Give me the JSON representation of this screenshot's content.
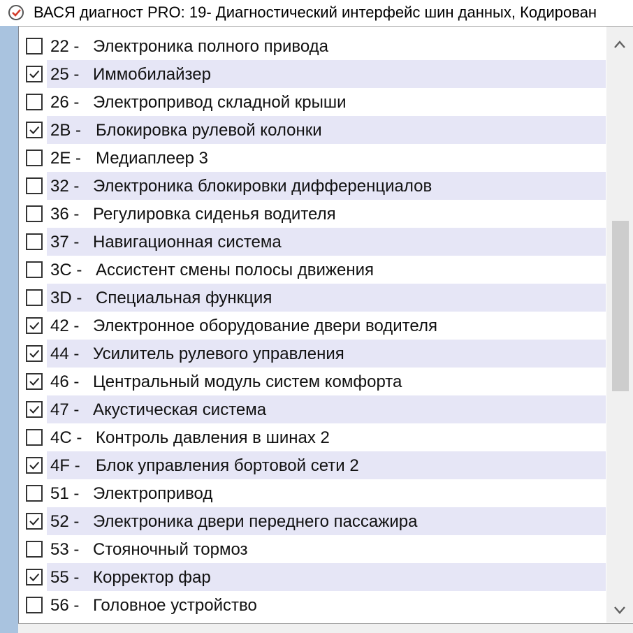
{
  "window": {
    "title": "ВАСЯ диагност PRO: 19- Диагностический интерфейс шин данных,  Кодирован"
  },
  "modules": [
    {
      "code": "22 -",
      "name": "Электроника полного привода",
      "checked": false
    },
    {
      "code": "25 -",
      "name": "Иммобилайзер",
      "checked": true
    },
    {
      "code": "26 -",
      "name": "Электропривод складной крыши",
      "checked": false
    },
    {
      "code": "2B -",
      "name": "Блокировка рулевой колонки",
      "checked": true
    },
    {
      "code": "2E -",
      "name": "Медиаплеер 3",
      "checked": false
    },
    {
      "code": "32 -",
      "name": "Электроника блокировки дифференциалов",
      "checked": false
    },
    {
      "code": "36 -",
      "name": "Регулировка сиденья водителя",
      "checked": false
    },
    {
      "code": "37 -",
      "name": "Навигационная система",
      "checked": false
    },
    {
      "code": "3C -",
      "name": "Ассистент смены полосы движения",
      "checked": false
    },
    {
      "code": "3D -",
      "name": "Специальная функция",
      "checked": false
    },
    {
      "code": "42 -",
      "name": "Электронное оборудование двери водителя",
      "checked": true
    },
    {
      "code": "44 -",
      "name": "Усилитель рулевого управления",
      "checked": true
    },
    {
      "code": "46 -",
      "name": "Центральный модуль систем комфорта",
      "checked": true
    },
    {
      "code": "47 -",
      "name": "Акустическая система",
      "checked": true
    },
    {
      "code": "4C -",
      "name": "Контроль давления в шинах 2",
      "checked": false
    },
    {
      "code": "4F -",
      "name": "Блок управления бортовой сети 2",
      "checked": true
    },
    {
      "code": "51 -",
      "name": "Электропривод",
      "checked": false
    },
    {
      "code": "52 -",
      "name": "Электроника двери переднего пассажира",
      "checked": true
    },
    {
      "code": "53 -",
      "name": "Стояночный тормоз",
      "checked": false
    },
    {
      "code": "55 -",
      "name": "Корректор фар",
      "checked": true
    },
    {
      "code": "56 -",
      "name": "Головное устройство",
      "checked": false
    }
  ],
  "colors": {
    "row_alt": "#e6e6f6",
    "left_strip": "#a9c3df",
    "scroll_thumb": "#cdcdcd"
  },
  "icons": {
    "app": "vasya-app-icon",
    "check": "check-icon",
    "scroll_up": "chevron-up-icon",
    "scroll_down": "chevron-down-icon"
  }
}
